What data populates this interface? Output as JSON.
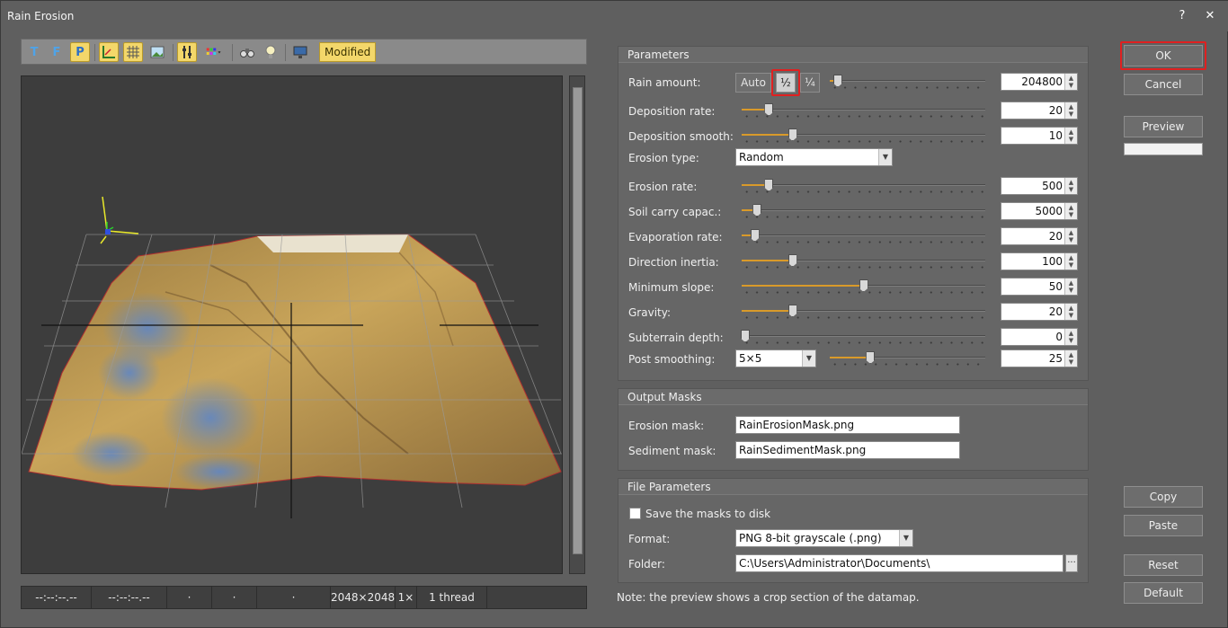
{
  "window": {
    "title": "Rain Erosion",
    "help_glyph": "?",
    "close_glyph": "✕"
  },
  "toolbar": {
    "modified_label": "Modified",
    "buttons": [
      "T",
      "F",
      "P"
    ]
  },
  "statusbar": {
    "cells": [
      "--:--:--.--",
      "--:--:--.--",
      "·",
      "·",
      "·",
      "2048×2048",
      "1×",
      "1 thread"
    ]
  },
  "parameters": {
    "title": "Parameters",
    "rain_amount": {
      "label": "Rain amount:",
      "auto": "Auto",
      "half": "½",
      "quarter": "¼",
      "value": "204800",
      "slider_fraction": 0.03
    },
    "rows": [
      {
        "label": "Deposition rate:",
        "value": "20",
        "slider_fraction": 0.1
      },
      {
        "label": "Deposition smooth:",
        "value": "10",
        "slider_fraction": 0.2
      },
      {
        "label": "Erosion rate:",
        "value": "500",
        "slider_fraction": 0.1
      },
      {
        "label": "Soil carry capac.:",
        "value": "5000",
        "slider_fraction": 0.05
      },
      {
        "label": "Evaporation rate:",
        "value": "20",
        "slider_fraction": 0.04
      },
      {
        "label": "Direction inertia:",
        "value": "100",
        "slider_fraction": 0.2
      },
      {
        "label": "Minimum slope:",
        "value": "50",
        "slider_fraction": 0.5
      },
      {
        "label": "Gravity:",
        "value": "20",
        "slider_fraction": 0.2
      },
      {
        "label": "Subterrain depth:",
        "value": "0",
        "slider_fraction": 0.0
      }
    ],
    "erosion_type": {
      "label": "Erosion type:",
      "value": "Random"
    },
    "post_smoothing": {
      "label": "Post smoothing:",
      "select": "5×5",
      "value": "25",
      "slider_fraction": 0.25
    }
  },
  "output_masks": {
    "title": "Output Masks",
    "erosion_label": "Erosion mask:",
    "erosion_value": "RainErosionMask.png",
    "sediment_label": "Sediment mask:",
    "sediment_value": "RainSedimentMask.png"
  },
  "file_parameters": {
    "title": "File Parameters",
    "save_label": "Save the masks to disk",
    "format_label": "Format:",
    "format_value": "PNG 8-bit grayscale (.png)",
    "folder_label": "Folder:",
    "folder_value": "C:\\Users\\Administrator\\Documents\\",
    "browse": "···"
  },
  "note": "Note: the preview shows a crop section of the datamap.",
  "buttons": {
    "ok": "OK",
    "cancel": "Cancel",
    "preview": "Preview",
    "copy": "Copy",
    "paste": "Paste",
    "reset": "Reset",
    "default": "Default"
  },
  "colors": {
    "accent": "#f3d76a",
    "highlight": "#e02020",
    "slider_fill": "#d99a2a"
  }
}
